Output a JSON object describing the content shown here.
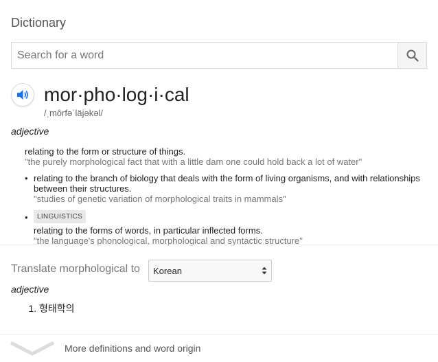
{
  "header": {
    "title": "Dictionary"
  },
  "search": {
    "placeholder": "Search for a word",
    "value": "",
    "icon": "search-icon"
  },
  "entry": {
    "headword": "mor·pho·log·i·cal",
    "phonetic": "/ˌmôrfəˈläjəkəl/",
    "speaker_icon": "speaker-icon",
    "part_of_speech": "adjective",
    "senses": [
      {
        "definition": "relating to the form or structure of things.",
        "example": "\"the purely morphological fact that with a little dam one could hold back a lot of water\""
      },
      {
        "definition": "relating to the branch of biology that deals with the form of living organisms, and with relationships between their structures.",
        "example": "\"studies of genetic variation of morphological traits in mammals\""
      },
      {
        "label": "LINGUISTICS",
        "definition": "relating to the forms of words, in particular inflected forms.",
        "example": "\"the language's phonological, morphological and syntactic structure\""
      }
    ]
  },
  "translate": {
    "label": "Translate morphological to",
    "selected_language": "Korean",
    "part_of_speech": "adjective",
    "results": [
      "형태학의"
    ]
  },
  "footer": {
    "more_label": "More definitions and word origin",
    "icon": "chevron-down-icon"
  },
  "colors": {
    "accent_blue": "#1a73e8",
    "text_gray": "#777777",
    "border": "#d9d9d9"
  }
}
